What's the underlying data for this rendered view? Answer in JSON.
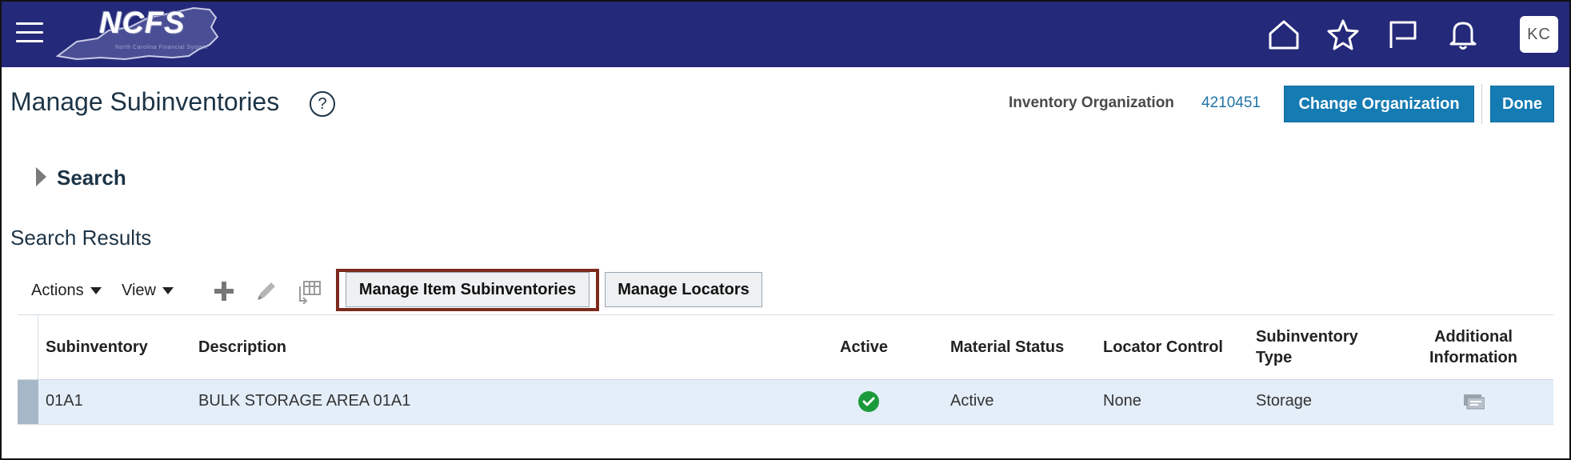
{
  "header": {
    "logo_text": "NCFS",
    "logo_subtext": "North Carolina Financial System",
    "icons": [
      "hamburger-menu-icon",
      "home-icon",
      "star-icon",
      "flag-icon",
      "bell-icon"
    ],
    "avatar_initials": "KC",
    "bar_color": "#25297a"
  },
  "page": {
    "title": "Manage Subinventories",
    "help_symbol": "?",
    "inventory_org_label": "Inventory Organization",
    "inventory_org_value": "4210451",
    "change_org_button": "Change Organization",
    "done_button": "Done"
  },
  "search": {
    "label": "Search",
    "results_title": "Search Results"
  },
  "toolbar": {
    "actions_label": "Actions",
    "view_label": "View",
    "icons": [
      "add-icon",
      "edit-icon",
      "freeze-columns-icon"
    ],
    "manage_item_subinventories_button": "Manage Item Subinventories",
    "manage_locators_button": "Manage Locators"
  },
  "table": {
    "headers": {
      "subinventory": "Subinventory",
      "description": "Description",
      "active": "Active",
      "material_status": "Material Status",
      "locator_control": "Locator Control",
      "subinventory_type_1": "Subinventory",
      "subinventory_type_2": "Type",
      "additional_info_1": "Additional",
      "additional_info_2": "Information"
    },
    "rows": [
      {
        "subinventory": "01A1",
        "description": "BULK STORAGE AREA 01A1",
        "active": true,
        "material_status": "Active",
        "locator_control": "None",
        "subinventory_type": "Storage",
        "additional_information_icon": "additional-info-icon"
      }
    ]
  },
  "colors": {
    "primary_button": "#157bb3",
    "highlight_outline": "#7b2a1c",
    "selected_row": "#e3eef9",
    "active_check": "#1b9a3a"
  }
}
